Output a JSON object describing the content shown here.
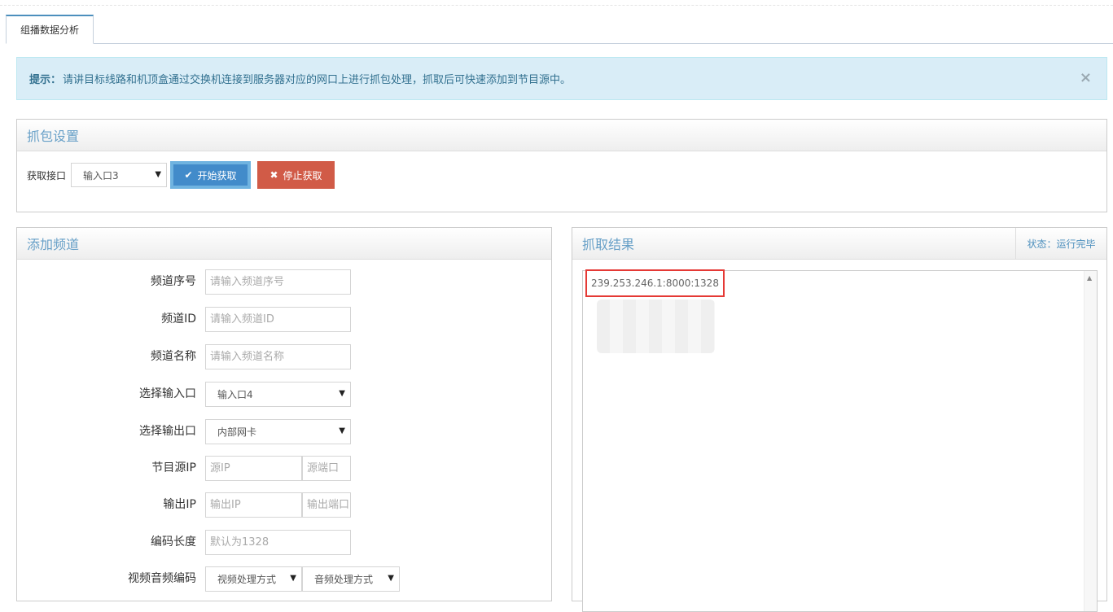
{
  "tabs": [
    {
      "label": "组播数据分析"
    }
  ],
  "alert": {
    "title": "提示：",
    "message": "请讲目标线路和机顶盒通过交换机连接到服务器对应的网口上进行抓包处理，抓取后可快速添加到节目源中。",
    "close": "×"
  },
  "capture": {
    "title": "抓包设置",
    "interface_label": "获取接口",
    "interface_value": "输入口3",
    "start_label": "开始获取",
    "stop_label": "停止获取",
    "start_icon": "check-icon",
    "stop_icon": "close-icon"
  },
  "add_channel": {
    "title": "添加频道",
    "channel_no": {
      "label": "频道序号",
      "placeholder": "请输入频道序号"
    },
    "channel_id": {
      "label": "频道ID",
      "placeholder": "请输入频道ID"
    },
    "channel_name": {
      "label": "频道名称",
      "placeholder": "请输入频道名称"
    },
    "input_port": {
      "label": "选择输入口",
      "value": "输入口4"
    },
    "output_port": {
      "label": "选择输出口",
      "value": "内部网卡"
    },
    "source_ip": {
      "label": "节目源IP",
      "ip_placeholder": "源IP",
      "port_placeholder": "源端口"
    },
    "output_ip": {
      "label": "输出IP",
      "ip_placeholder": "输出IP",
      "port_placeholder": "输出端口"
    },
    "encode_length": {
      "label": "编码长度",
      "placeholder": "默认为1328"
    },
    "av_codec": {
      "label": "视频音频编码",
      "video_value": "视频处理方式",
      "audio_value": "音频处理方式"
    }
  },
  "results": {
    "title": "抓取结果",
    "status": "状态：运行完毕",
    "lines": [
      "239.253.246.1:8000:1328"
    ]
  },
  "colors": {
    "primary": "#428bca",
    "danger": "#d15b47",
    "panel_title": "#669fc7",
    "alert_bg": "#d9edf7",
    "highlight": "#e53935"
  }
}
